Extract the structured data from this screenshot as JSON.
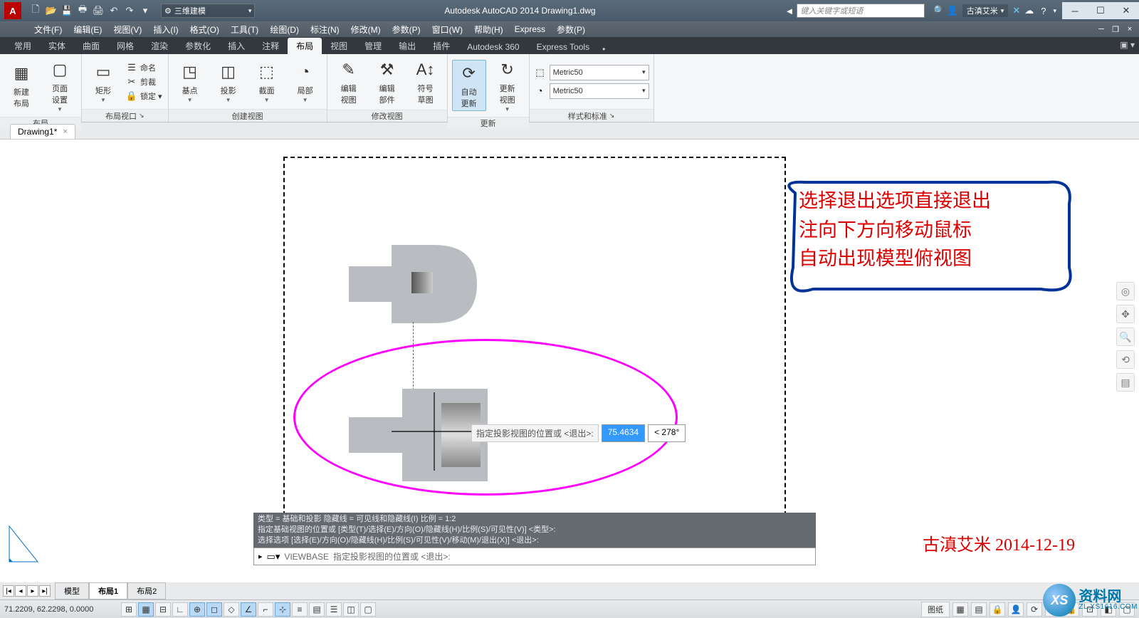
{
  "titlebar": {
    "logo": "A",
    "workspace_icon": "⚙",
    "workspace": "三维建模",
    "title": "Autodesk AutoCAD 2014    Drawing1.dwg",
    "search_placeholder": "键入关键字或短语",
    "user": "古滇艾米",
    "help_icon": "?"
  },
  "menubar": {
    "items": [
      "文件(F)",
      "编辑(E)",
      "视图(V)",
      "插入(I)",
      "格式(O)",
      "工具(T)",
      "绘图(D)",
      "标注(N)",
      "修改(M)",
      "参数(P)",
      "窗口(W)",
      "帮助(H)",
      "Express",
      "参数(P)"
    ]
  },
  "tabs": {
    "items": [
      "常用",
      "实体",
      "曲面",
      "网格",
      "渲染",
      "参数化",
      "插入",
      "注释",
      "布局",
      "视图",
      "管理",
      "输出",
      "插件",
      "Autodesk 360",
      "Express Tools"
    ],
    "active": 8,
    "expand": "▣ ▾"
  },
  "ribbon": {
    "panels": [
      {
        "title": "布局",
        "big": [
          {
            "icon": "▦",
            "label": "新建\n布局"
          },
          {
            "icon": "▢",
            "label": "页面\n设置",
            "dd": true
          }
        ]
      },
      {
        "title": "布局视口",
        "big": [
          {
            "icon": "▭",
            "label": "矩形",
            "dd": true
          }
        ],
        "small": [
          {
            "icon": "☰",
            "label": "命名"
          },
          {
            "icon": "✂",
            "label": "剪裁"
          },
          {
            "icon": "🔒",
            "label": "锁定 ▾"
          }
        ]
      },
      {
        "title": "创建视图",
        "big": [
          {
            "icon": "◳",
            "label": "基点",
            "dd": true
          },
          {
            "icon": "◫",
            "label": "投影",
            "dd": true
          },
          {
            "icon": "⬚",
            "label": "截面",
            "dd": true
          },
          {
            "icon": "◔",
            "label": "局部",
            "dd": true
          }
        ]
      },
      {
        "title": "修改视图",
        "big": [
          {
            "icon": "✎",
            "label": "编辑\n视图"
          },
          {
            "icon": "⚒",
            "label": "编辑\n部件"
          },
          {
            "icon": "A↕",
            "label": "符号\n草图"
          }
        ]
      },
      {
        "title": "更新",
        "big": [
          {
            "icon": "⟳",
            "label": "自动\n更新",
            "hl": true
          },
          {
            "icon": "↻",
            "label": "更新\n视图",
            "dd": true
          }
        ]
      },
      {
        "title": "样式和标准",
        "styles": [
          {
            "icon": "⬚",
            "value": "Metric50"
          },
          {
            "icon": "◔",
            "value": "Metric50"
          }
        ]
      }
    ]
  },
  "filetabs": {
    "active": "Drawing1*"
  },
  "dynamic_input": {
    "label": "指定投影视图的位置或 <退出>:",
    "val1": "75.4634",
    "val2": "< 278°"
  },
  "annotation": {
    "line1": "选择退出选项直接退出",
    "line2": "注向下方向移动鼠标",
    "line3": "自动出现模型俯视图"
  },
  "cmd": {
    "hist1": "类型 = 基础和投影  隐藏线 = 可见线和隐藏线(I)  比例 = 1:2",
    "hist2": "指定基础视图的位置或 [类型(T)/选择(E)/方向(O)/隐藏线(H)/比例(S)/可见性(V)] <类型>:",
    "hist3": "选择选项 [选择(E)/方向(O)/隐藏线(H)/比例(S)/可见性(V)/移动(M)/退出(X)] <退出>:",
    "prompt_cmd": "VIEWBASE",
    "prompt_text": "指定投影视图的位置或 <退出>:"
  },
  "layout_tabs": {
    "items": [
      "模型",
      "布局1",
      "布局2"
    ],
    "active": 1
  },
  "statusbar": {
    "coords": "71.2209, 62.2298, 0.0000",
    "paper": "图纸"
  },
  "watermark": {
    "sig": "古滇艾米 2014-12-19",
    "cn": "资料网",
    "en": "ZL.XS1616.COM",
    "xs": "XS"
  }
}
